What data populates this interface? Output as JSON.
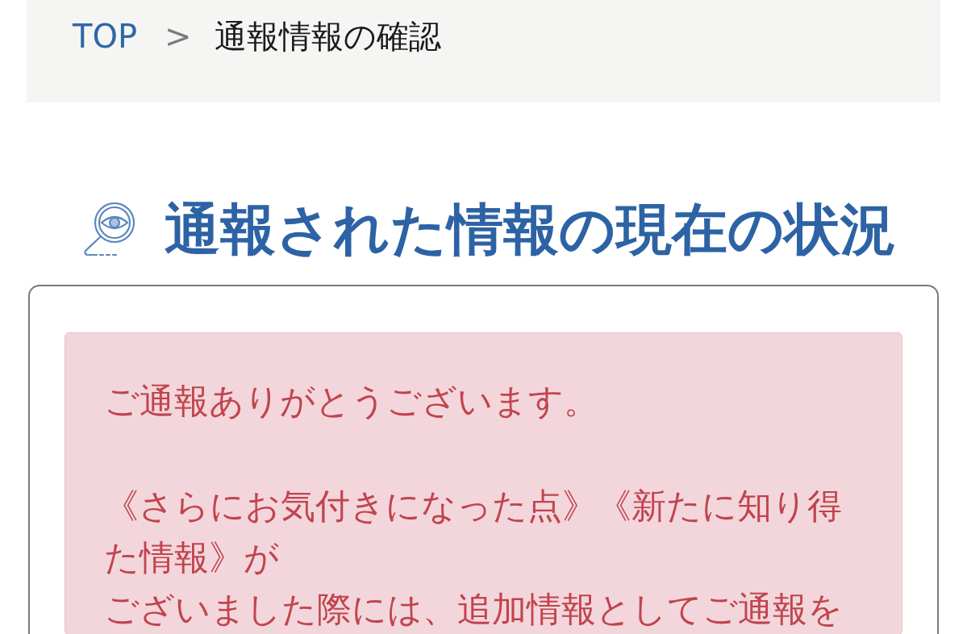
{
  "breadcrumb": {
    "items": [
      {
        "label": "TOP",
        "kind": "link"
      },
      {
        "label": "通報情報の確認",
        "kind": "current"
      }
    ],
    "separator": ">"
  },
  "heading": {
    "title": "通報された情報の現在の状況"
  },
  "notice": {
    "paragraphs": [
      {
        "lines": [
          "ご通報ありがとうございます。"
        ]
      },
      {
        "lines": [
          "《さらにお気付きになった点》《新たに知り得",
          "た情報》が",
          "ございました際には、追加情報としてご通報を"
        ]
      }
    ]
  }
}
